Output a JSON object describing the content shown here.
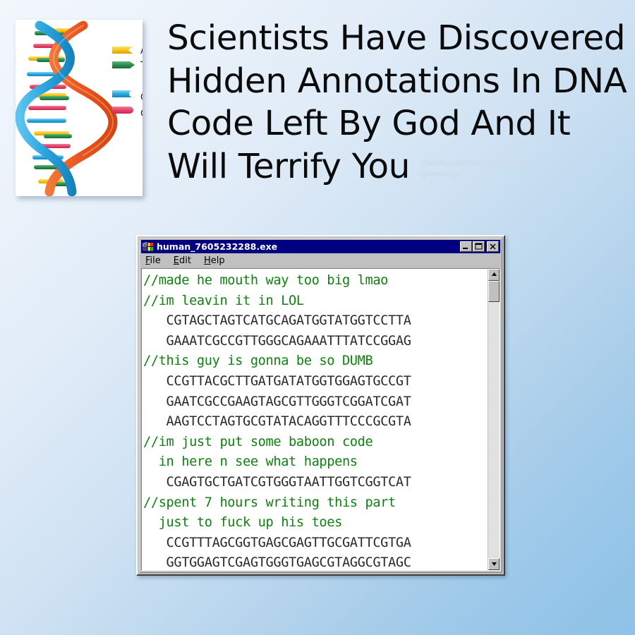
{
  "background": {
    "gradient_from": "#f2f7fc",
    "gradient_to": "#8ec2e7"
  },
  "headline": {
    "lines": [
      "Scientists Have Discovered",
      "Hidden Annotations In DNA",
      "Code Left By God And It",
      "Will Terrify You"
    ],
    "color": "#0b0b0b"
  },
  "watermark": {
    "line1": "@welcometomymemepage",
    "line2": "@wtmmp",
    "color": "#ccdcec"
  },
  "dna_image": {
    "alt": "dna-double-helix-illustration",
    "legend": [
      {
        "label": "A",
        "color": "#f5c518",
        "end": "concave"
      },
      {
        "label": "T",
        "color": "#2e8b4f",
        "end": "point"
      },
      {
        "label": "C",
        "color": "#29a8e0",
        "end": "concave"
      },
      {
        "label": "G",
        "color": "#e8436b",
        "end": "round"
      }
    ],
    "strand_colors": [
      "#e8602c",
      "#2aa3dd"
    ]
  },
  "window": {
    "title": "human_7605232288.exe",
    "titlebar_color": "#000080",
    "icon": "windows-program-icon",
    "controls": [
      {
        "name": "minimize",
        "glyph": "_"
      },
      {
        "name": "maximize",
        "glyph": "□"
      },
      {
        "name": "close",
        "glyph": "×"
      }
    ],
    "menu": [
      {
        "accel": "F",
        "rest": "ile"
      },
      {
        "accel": "E",
        "rest": "dit"
      },
      {
        "accel": "H",
        "rest": "elp"
      }
    ],
    "comment_color": "#108010",
    "sequence_color": "#2b2b2b",
    "code_lines": [
      {
        "type": "comment",
        "text": "//made he mouth way too big lmao"
      },
      {
        "type": "comment",
        "text": "//im leavin it in LOL"
      },
      {
        "type": "seq",
        "text": "   CGTAGCTAGTCATGCAGATGGTATGGTCCTTA"
      },
      {
        "type": "seq",
        "text": "   GAAATCGCCGTTGGGCAGAAATTTATCCGGAG"
      },
      {
        "type": "comment",
        "text": "//this guy is gonna be so DUMB"
      },
      {
        "type": "seq",
        "text": "   CCGTTACGCTTGATGATATGGTGGAGTGCCGT"
      },
      {
        "type": "seq",
        "text": "   GAATCGCCGAAGTAGCGTTGGGTCGGATCGAT"
      },
      {
        "type": "seq",
        "text": "   AAGTCCTAGTGCGTATACAGGTTTCCCGCGTA"
      },
      {
        "type": "comment",
        "text": "//im just put some baboon code"
      },
      {
        "type": "comment",
        "text": "  in here n see what happens"
      },
      {
        "type": "seq",
        "text": "   CGAGTGCTGATCGTGGGTAATTGGTCGGTCAT"
      },
      {
        "type": "comment",
        "text": "//spent 7 hours writing this part"
      },
      {
        "type": "comment",
        "text": "  just to fuck up his toes"
      },
      {
        "type": "seq",
        "text": "   CCGTTTAGCGGTGAGCGAGTTGCGATTCGTGA"
      },
      {
        "type": "seq",
        "text": "   GGTGGAGTCGAGTGGGTGAGCGTAGGCGTAGC"
      }
    ],
    "scrollbar": {
      "up_arrow": "scroll-up-arrow",
      "down_arrow": "scroll-down-arrow",
      "thumb_position": "top"
    }
  }
}
